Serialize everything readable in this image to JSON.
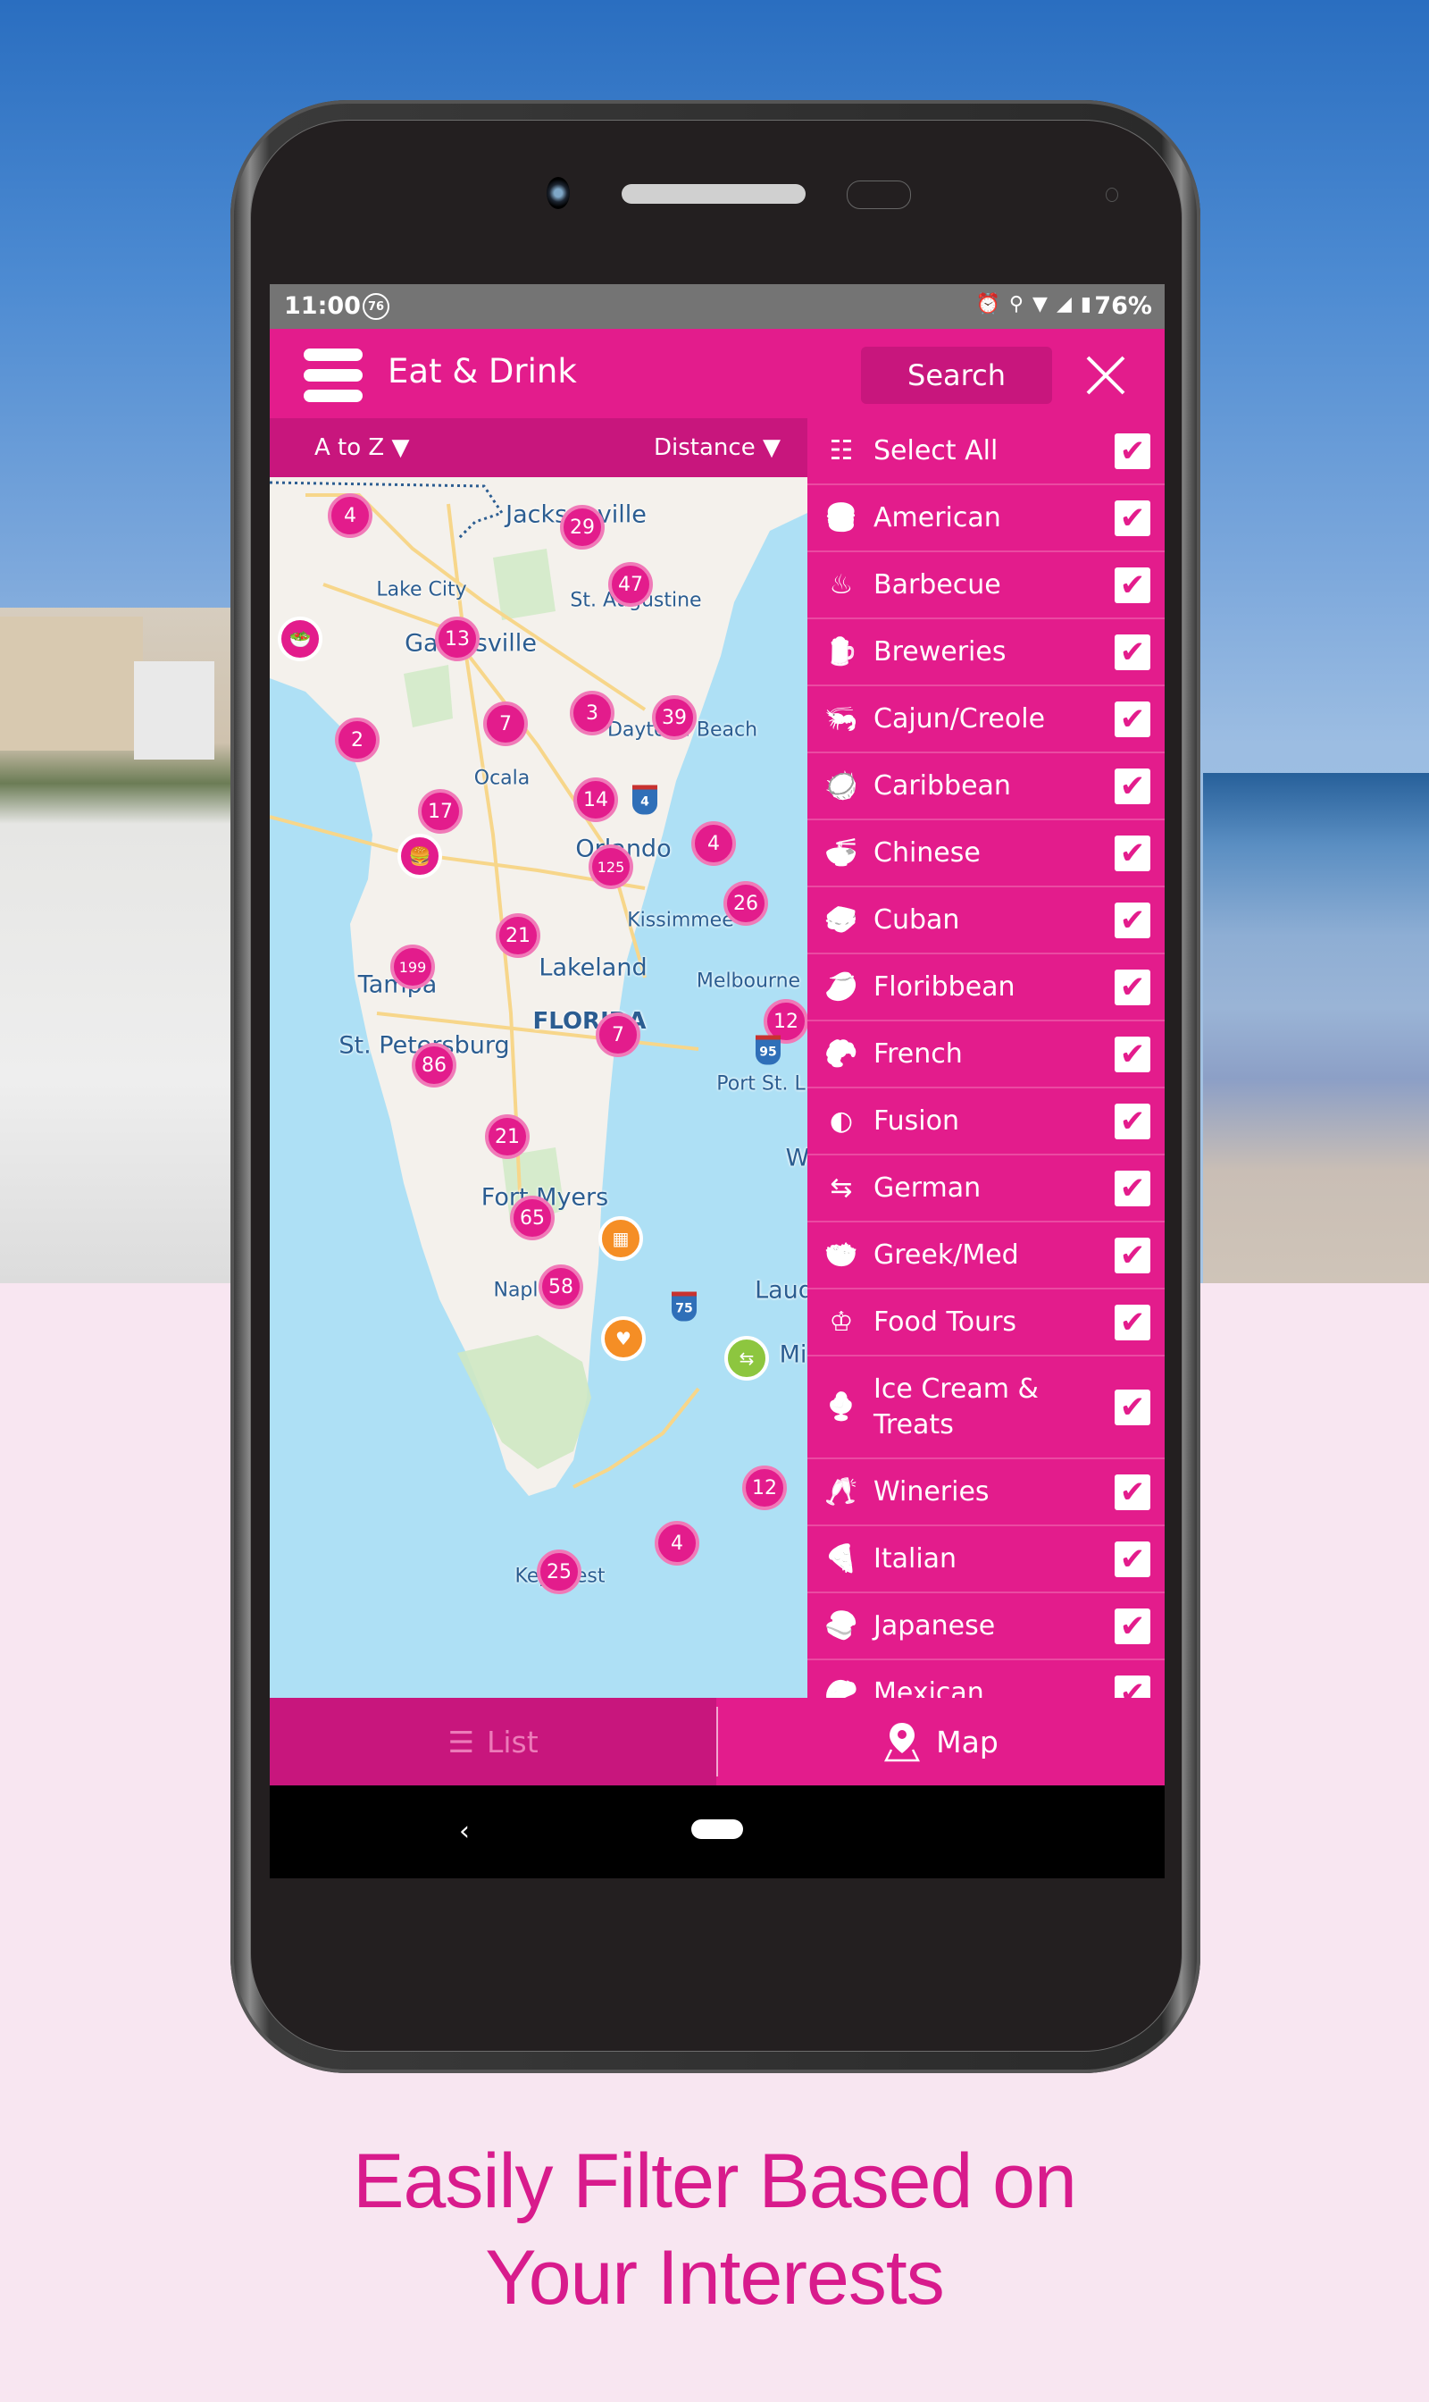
{
  "status_bar": {
    "time": "11:00",
    "notification_badge": "76",
    "icons": [
      "alarm-icon",
      "location-icon",
      "wifi-icon",
      "signal-icon"
    ],
    "battery": "76%"
  },
  "app_bar": {
    "title": "Eat & Drink",
    "search_label": "Search"
  },
  "sort_bar": {
    "sort_alpha": "A to Z",
    "sort_distance": "Distance"
  },
  "filter_drawer": {
    "items": [
      {
        "label": "Select All",
        "icon": "select-all-icon",
        "checked": true
      },
      {
        "label": "American",
        "icon": "burger-drink-icon",
        "checked": true
      },
      {
        "label": "Barbecue",
        "icon": "grill-icon",
        "checked": true
      },
      {
        "label": "Breweries",
        "icon": "beer-mug-icon",
        "checked": true
      },
      {
        "label": "Cajun/Creole",
        "icon": "shrimp-icon",
        "checked": true
      },
      {
        "label": "Caribbean",
        "icon": "coconut-icon",
        "checked": true
      },
      {
        "label": "Chinese",
        "icon": "noodle-bowl-icon",
        "checked": true
      },
      {
        "label": "Cuban",
        "icon": "sandwich-icon",
        "checked": true
      },
      {
        "label": "Floribbean",
        "icon": "mango-icon",
        "checked": true
      },
      {
        "label": "French",
        "icon": "croissant-icon",
        "checked": true
      },
      {
        "label": "Fusion",
        "icon": "fusion-circles-icon",
        "checked": true
      },
      {
        "label": "German",
        "icon": "signpost-icon",
        "checked": true
      },
      {
        "label": "Greek/Med",
        "icon": "salad-bowl-icon",
        "checked": true
      },
      {
        "label": "Food Tours",
        "icon": "chef-hat-icon",
        "checked": true
      },
      {
        "label": "Ice Cream & Treats",
        "icon": "ice-cream-icon",
        "checked": true
      },
      {
        "label": "Wineries",
        "icon": "wine-glasses-icon",
        "checked": true
      },
      {
        "label": "Italian",
        "icon": "pizza-icon",
        "checked": true
      },
      {
        "label": "Japanese",
        "icon": "sushi-icon",
        "checked": true
      },
      {
        "label": "Mexican",
        "icon": "mexican-icon",
        "checked": true
      }
    ],
    "check_glyph": "✔"
  },
  "map": {
    "cities": [
      {
        "name": "Jacksonville"
      },
      {
        "name": "Lake City"
      },
      {
        "name": "St. Augustine"
      },
      {
        "name": "Gainesville"
      },
      {
        "name": "Daytona Beach"
      },
      {
        "name": "Ocala"
      },
      {
        "name": "Orlando"
      },
      {
        "name": "Kissimmee"
      },
      {
        "name": "Tampa"
      },
      {
        "name": "Lakeland"
      },
      {
        "name": "Melbourne"
      },
      {
        "name": "FLORIDA"
      },
      {
        "name": "St. Petersburg"
      },
      {
        "name": "Port St. L"
      },
      {
        "name": "Fort Myers"
      },
      {
        "name": "Naples"
      },
      {
        "name": "Laud"
      },
      {
        "name": "Mi"
      },
      {
        "name": "Key West"
      },
      {
        "name": "W"
      }
    ],
    "clusters": [
      {
        "count": "4"
      },
      {
        "count": "29"
      },
      {
        "count": "47"
      },
      {
        "count": "13"
      },
      {
        "count": "7"
      },
      {
        "count": "3"
      },
      {
        "count": "39"
      },
      {
        "count": "2"
      },
      {
        "count": "17"
      },
      {
        "count": "14"
      },
      {
        "count": "4"
      },
      {
        "count": "125"
      },
      {
        "count": "26"
      },
      {
        "count": "21"
      },
      {
        "count": "199"
      },
      {
        "count": "12"
      },
      {
        "count": "7"
      },
      {
        "count": "86"
      },
      {
        "count": "21"
      },
      {
        "count": "65"
      },
      {
        "count": "58"
      },
      {
        "count": "12"
      },
      {
        "count": "4"
      },
      {
        "count": "25"
      }
    ],
    "highway_shields": [
      "4",
      "95",
      "75"
    ]
  },
  "bottom_tabs": {
    "list_label": "List",
    "map_label": "Map",
    "active": "Map"
  },
  "nav_bar": {
    "back_glyph": "‹"
  },
  "caption": {
    "line1": "Easily Filter Based on",
    "line2": "Your Interests"
  },
  "colors": {
    "brand_pink": "#e31c8c",
    "brand_pink_dark": "#c8167d",
    "caption_pink": "#d81b8c",
    "map_water": "#aee0f5"
  }
}
